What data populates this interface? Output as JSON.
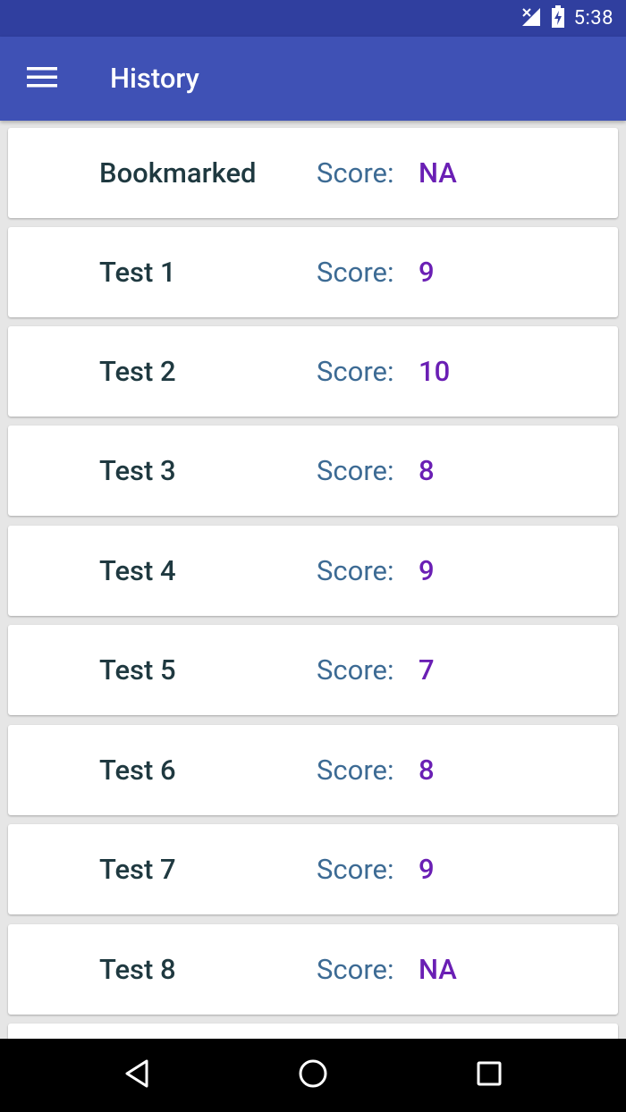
{
  "status_bar": {
    "time": "5:38",
    "icons": [
      "signal-off-icon",
      "battery-charging-icon"
    ]
  },
  "app_bar": {
    "title": "History",
    "menu_icon": "hamburger-menu-icon"
  },
  "history": {
    "score_label": "Score:",
    "items": [
      {
        "name": "Bookmarked",
        "score": "NA"
      },
      {
        "name": "Test 1",
        "score": "9"
      },
      {
        "name": "Test 2",
        "score": "10"
      },
      {
        "name": "Test 3",
        "score": "8"
      },
      {
        "name": "Test 4",
        "score": "9"
      },
      {
        "name": "Test 5",
        "score": "7"
      },
      {
        "name": "Test 6",
        "score": "8"
      },
      {
        "name": "Test 7",
        "score": "9"
      },
      {
        "name": "Test 8",
        "score": "NA"
      },
      {
        "name": "",
        "score": ""
      }
    ]
  },
  "nav_bar": {
    "buttons": [
      "back-icon",
      "home-icon",
      "recents-icon"
    ]
  },
  "colors": {
    "status_bar": "#303f9f",
    "app_bar": "#3f51b5",
    "item_name": "#1f3940",
    "score_label": "#3d6b94",
    "score_value": "#6a1fb4"
  }
}
